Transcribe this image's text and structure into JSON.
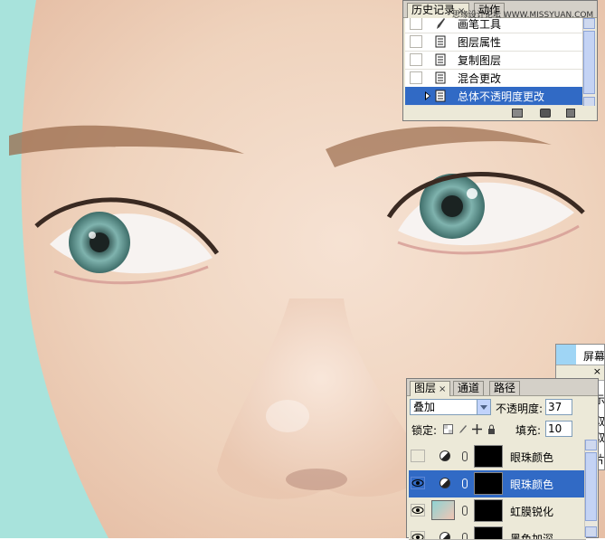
{
  "watermark": "思缘设计论坛 WWW.MISSYUAN.COM",
  "history_panel": {
    "tabs": [
      {
        "label": "历史记录",
        "active": true
      },
      {
        "label": "动作",
        "active": false
      }
    ],
    "close_symbol": "×",
    "items": [
      {
        "label": "画笔工具",
        "icon": "brush-icon",
        "selected": false
      },
      {
        "label": "图层属性",
        "icon": "document-icon",
        "selected": false
      },
      {
        "label": "复制图层",
        "icon": "document-icon",
        "selected": false
      },
      {
        "label": "混合更改",
        "icon": "document-icon",
        "selected": false
      },
      {
        "label": "总体不透明度更改",
        "icon": "document-icon",
        "selected": true
      }
    ],
    "footer_icons": [
      "new-document-from-state-icon",
      "new-snapshot-icon",
      "trash-icon"
    ]
  },
  "layers_panel": {
    "tabs": [
      {
        "label": "图层",
        "active": true
      },
      {
        "label": "通道",
        "active": false
      },
      {
        "label": "路径",
        "active": false
      }
    ],
    "close_symbol": "×",
    "blend_mode": "叠加",
    "opacity_label": "不透明度:",
    "opacity_value": "37",
    "lock_label": "锁定:",
    "fill_label": "填充:",
    "fill_value": "10",
    "layers": [
      {
        "name": "眼珠颜色",
        "visible": false,
        "selected": false,
        "kind": "adjustment"
      },
      {
        "name": "眼珠颜色",
        "visible": true,
        "selected": true,
        "kind": "adjustment"
      },
      {
        "name": "虹膜锐化",
        "visible": true,
        "selected": false,
        "kind": "image"
      },
      {
        "name": "黑色加深",
        "visible": true,
        "selected": false,
        "kind": "adjustment"
      }
    ]
  },
  "side_panel": {
    "items": [
      "屏幕",
      "显示",
      "截取",
      "截取",
      "影片"
    ],
    "close_symbol": "×"
  },
  "colors": {
    "selection": "#316ac5",
    "panel_bg": "#ece9d8",
    "background_teal": "#a8e3dc",
    "skin": "#f0d6c2"
  }
}
